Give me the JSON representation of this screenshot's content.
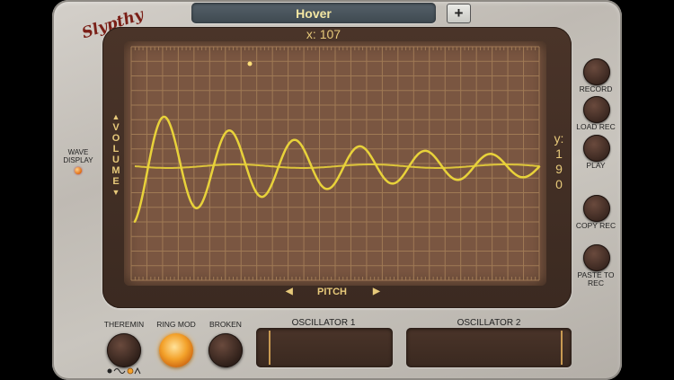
{
  "app": {
    "logo_text": "Slypthy"
  },
  "toolbar": {
    "preset_name": "Hover",
    "add_label": "+"
  },
  "display": {
    "x_readout": "x: 107",
    "y_readout_label": "y:",
    "y_readout_digits": [
      "1",
      "9",
      "0"
    ],
    "volume_letters": [
      "V",
      "O",
      "L",
      "U",
      "M",
      "E"
    ],
    "pitch_label": "PITCH",
    "up_arrow": "▲",
    "down_arrow": "▼",
    "left_arrow": "◀",
    "right_arrow": "▶",
    "wave_color": "#e8d23a",
    "grid_color": "#a07a55",
    "screen_color": "#7a5641"
  },
  "wave_display": {
    "label_line1": "WAVE",
    "label_line2": "DISPLAY",
    "led_on": true
  },
  "side_buttons": {
    "record": "RECORD",
    "load_rec": "LOAD REC",
    "play": "PLAY",
    "copy_rec": "COPY REC",
    "paste_to_rec_1": "PASTE TO",
    "paste_to_rec_2": "REC"
  },
  "bottom": {
    "theremin": "THEREMIN",
    "ring_mod": "RING MOD",
    "broken": "BROKEN",
    "oscillator1": "OSCILLATOR 1",
    "oscillator2": "OSCILLATOR 2",
    "ring_mod_active": true,
    "wave_selector_icons": [
      "sine-wave-icon",
      "square-wave-icon",
      "triangle-wave-icon"
    ]
  }
}
